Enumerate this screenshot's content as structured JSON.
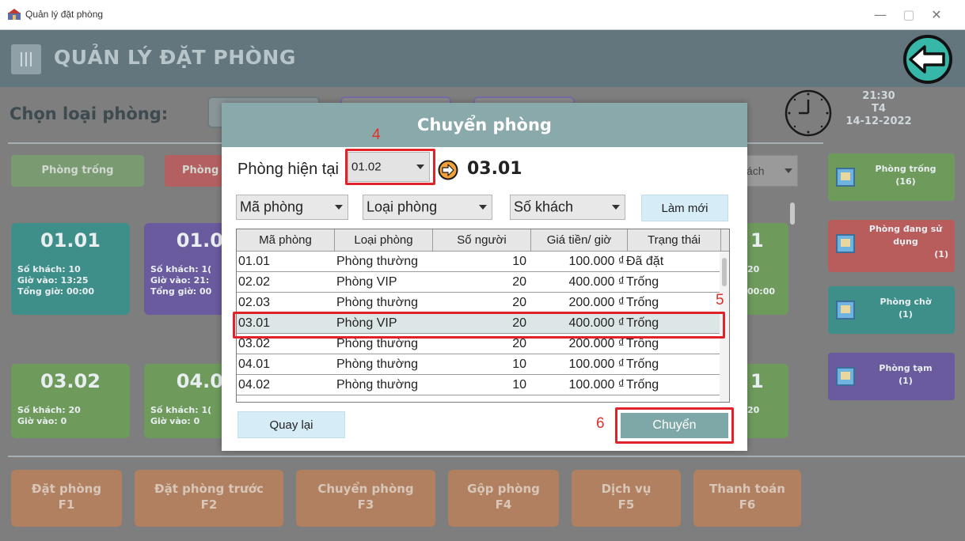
{
  "window": {
    "title": "Quản lý đặt phòng",
    "minimize_glyph": "—",
    "maximize_glyph": "▢",
    "close_glyph": "✕"
  },
  "header": {
    "title": "QUẢN LÝ ĐẶT PHÒNG",
    "menu_icon": "menu-icon",
    "back_icon": "back-arrow-icon"
  },
  "room_type": {
    "label": "Chọn loại phòng:"
  },
  "clock": {
    "time": "21:30",
    "day": "T4",
    "date": "14-12-2022"
  },
  "filters": {
    "empty": "Phòng trống",
    "occupied": "Phòng"
  },
  "behind_sort": {
    "guests_partial": "ách"
  },
  "cards": [
    {
      "id": "01.01",
      "guests": "Số khách: 10",
      "checkin": "Giờ vào: 13:25",
      "total": "Tổng giờ: 00:00",
      "color": "#3e8f8a"
    },
    {
      "id": "01.0",
      "guests": "Số khách: 1(",
      "checkin": "Giờ vào: 21:",
      "total": "Tổng giờ: 00",
      "color": "#6a5a9e"
    },
    {
      "id": "03.02",
      "guests": "Số khách: 20",
      "checkin": "Giờ vào: 0",
      "total": "",
      "color": "#6e9a5c"
    },
    {
      "id": "04.0",
      "guests": "Số khách: 1(",
      "checkin": "Giờ vào: 0",
      "total": "",
      "color": "#6e9a5c"
    }
  ],
  "right_cards_partial": [
    {
      "id": "1",
      "line1": "20",
      "line2": "00:00"
    },
    {
      "id": "1",
      "line1": "20",
      "line2": ""
    }
  ],
  "sidebar": [
    {
      "label": "Phòng trống",
      "count": "(16)",
      "color": "#6e9a5c"
    },
    {
      "label": "Phòng đang sử dụng",
      "count": "(1)",
      "color": "#b85c5c"
    },
    {
      "label": "Phòng chờ",
      "count": "(1)",
      "color": "#3e8f8a"
    },
    {
      "label": "Phòng tạm",
      "count": "(1)",
      "color": "#6a5a9e"
    }
  ],
  "functions": [
    {
      "label": "Đặt phòng",
      "key": "F1"
    },
    {
      "label": "Đặt phòng trước",
      "key": "F2"
    },
    {
      "label": "Chuyển phòng",
      "key": "F3"
    },
    {
      "label": "Gộp phòng",
      "key": "F4"
    },
    {
      "label": "Dịch vụ",
      "key": "F5"
    },
    {
      "label": "Thanh toán",
      "key": "F6"
    }
  ],
  "dialog": {
    "title": "Chuyển phòng",
    "current_room_label": "Phòng hiện tại",
    "current_room_value": "01.02",
    "target_room": "03.01",
    "sort_room_code": "Mã phòng",
    "sort_room_type": "Loại phòng",
    "sort_guests": "Số khách",
    "refresh_label": "Làm mới",
    "back_label": "Quay lại",
    "transfer_label": "Chuyển",
    "annotations": {
      "a4": "4",
      "a5": "5",
      "a6": "6"
    },
    "columns": [
      "Mã phòng",
      "Loại phòng",
      "Số người",
      "Giá tiền/ giờ",
      "Trạng thái"
    ],
    "rows": [
      {
        "code": "01.01",
        "type": "Phòng thường",
        "people": "10",
        "price": "100.000 ₫",
        "status": "Đã đặt"
      },
      {
        "code": "02.02",
        "type": "Phòng VIP",
        "people": "20",
        "price": "400.000 ₫",
        "status": "Trống"
      },
      {
        "code": "02.03",
        "type": "Phòng thường",
        "people": "20",
        "price": "200.000 ₫",
        "status": "Trống"
      },
      {
        "code": "03.01",
        "type": "Phòng VIP",
        "people": "20",
        "price": "400.000 ₫",
        "status": "Trống"
      },
      {
        "code": "03.02",
        "type": "Phòng thường",
        "people": "20",
        "price": "200.000 ₫",
        "status": "Trống"
      },
      {
        "code": "04.01",
        "type": "Phòng thường",
        "people": "10",
        "price": "100.000 ₫",
        "status": "Trống"
      },
      {
        "code": "04.02",
        "type": "Phòng thường",
        "people": "10",
        "price": "100.000 ₫",
        "status": "Trống"
      }
    ],
    "selected_row_index": 3
  }
}
